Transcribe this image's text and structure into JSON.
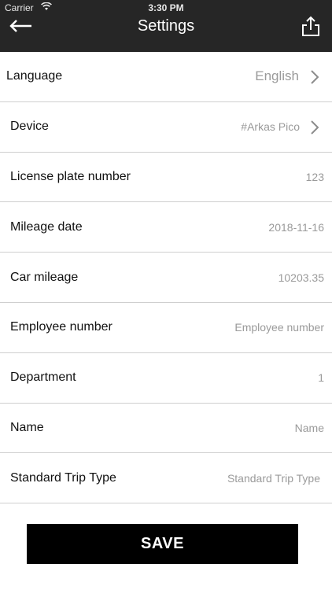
{
  "status_bar": {
    "carrier": "Carrier",
    "time": "3:30 PM"
  },
  "header": {
    "title": "Settings",
    "back_icon": "arrow-left-icon",
    "share_icon": "share-icon"
  },
  "settings": [
    {
      "label": "Language",
      "value": "English",
      "has_chevron": true
    },
    {
      "label": "Device",
      "value": "#Arkas Pico",
      "has_chevron": true
    },
    {
      "label": "License plate number",
      "value": "123"
    },
    {
      "label": "Mileage date",
      "value": "2018-11-16"
    },
    {
      "label": "Car mileage",
      "value": "10203.35"
    },
    {
      "label": "Employee number",
      "placeholder": "Employee number"
    },
    {
      "label": "Department",
      "value": "1"
    },
    {
      "label": "Name",
      "placeholder": "Name"
    },
    {
      "label": "Standard Trip Type",
      "placeholder": "Standard Trip Type"
    }
  ],
  "save_button": {
    "label": "SAVE"
  },
  "colors": {
    "header_bg": "#262626",
    "button_bg": "#000000",
    "muted_text": "#9a9a9a"
  }
}
